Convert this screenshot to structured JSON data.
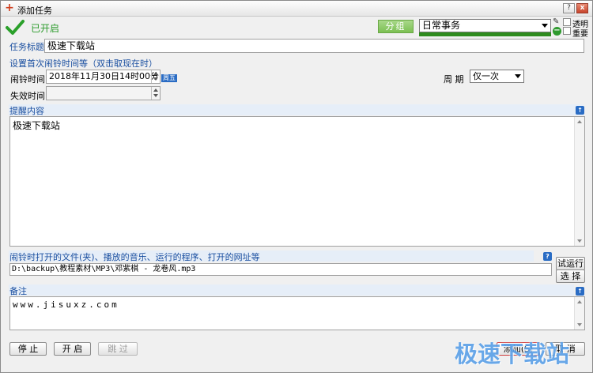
{
  "window": {
    "title": "添加任务",
    "help_label": "?",
    "close_label": "x"
  },
  "header": {
    "status_text": "已开启",
    "group_button": "分组",
    "category_value": "日常事务",
    "transparent_label": "透明",
    "top_label": "重要",
    "accent_color": "#2e8b1e"
  },
  "form": {
    "task_title_label": "任务标题",
    "task_title_value": "极速下载站",
    "first_time_section": "设置首次闹铃时间等（双击取现在时）",
    "alarm_time_label": "闹铃时间",
    "alarm_time_value": "2018年11月30日14时00分",
    "week_badge": "周五",
    "expire_time_label": "失效时间",
    "expire_time_value": "",
    "cycle_label": "周  期",
    "cycle_value": "仅一次"
  },
  "reminder": {
    "section_label": "提醒内容",
    "content": "极速下载站"
  },
  "open_file": {
    "section_label": "闹铃时打开的文件(夹)、播放的音乐、运行的程序、打开的网址等",
    "path_value": "D:\\backup\\教程素材\\MP3\\邓紫棋 - 龙卷风.mp3",
    "test_run_label": "试运行",
    "choose_label": "选 择"
  },
  "memo": {
    "section_label": "备注",
    "content": "www.jisuxz.com"
  },
  "footer": {
    "stop_label": "停 止",
    "start_label": "开 启",
    "skip_label": "跳 过",
    "add_label": "添加(S)",
    "cancel_label": "取 消"
  },
  "watermark": "极速下载站"
}
